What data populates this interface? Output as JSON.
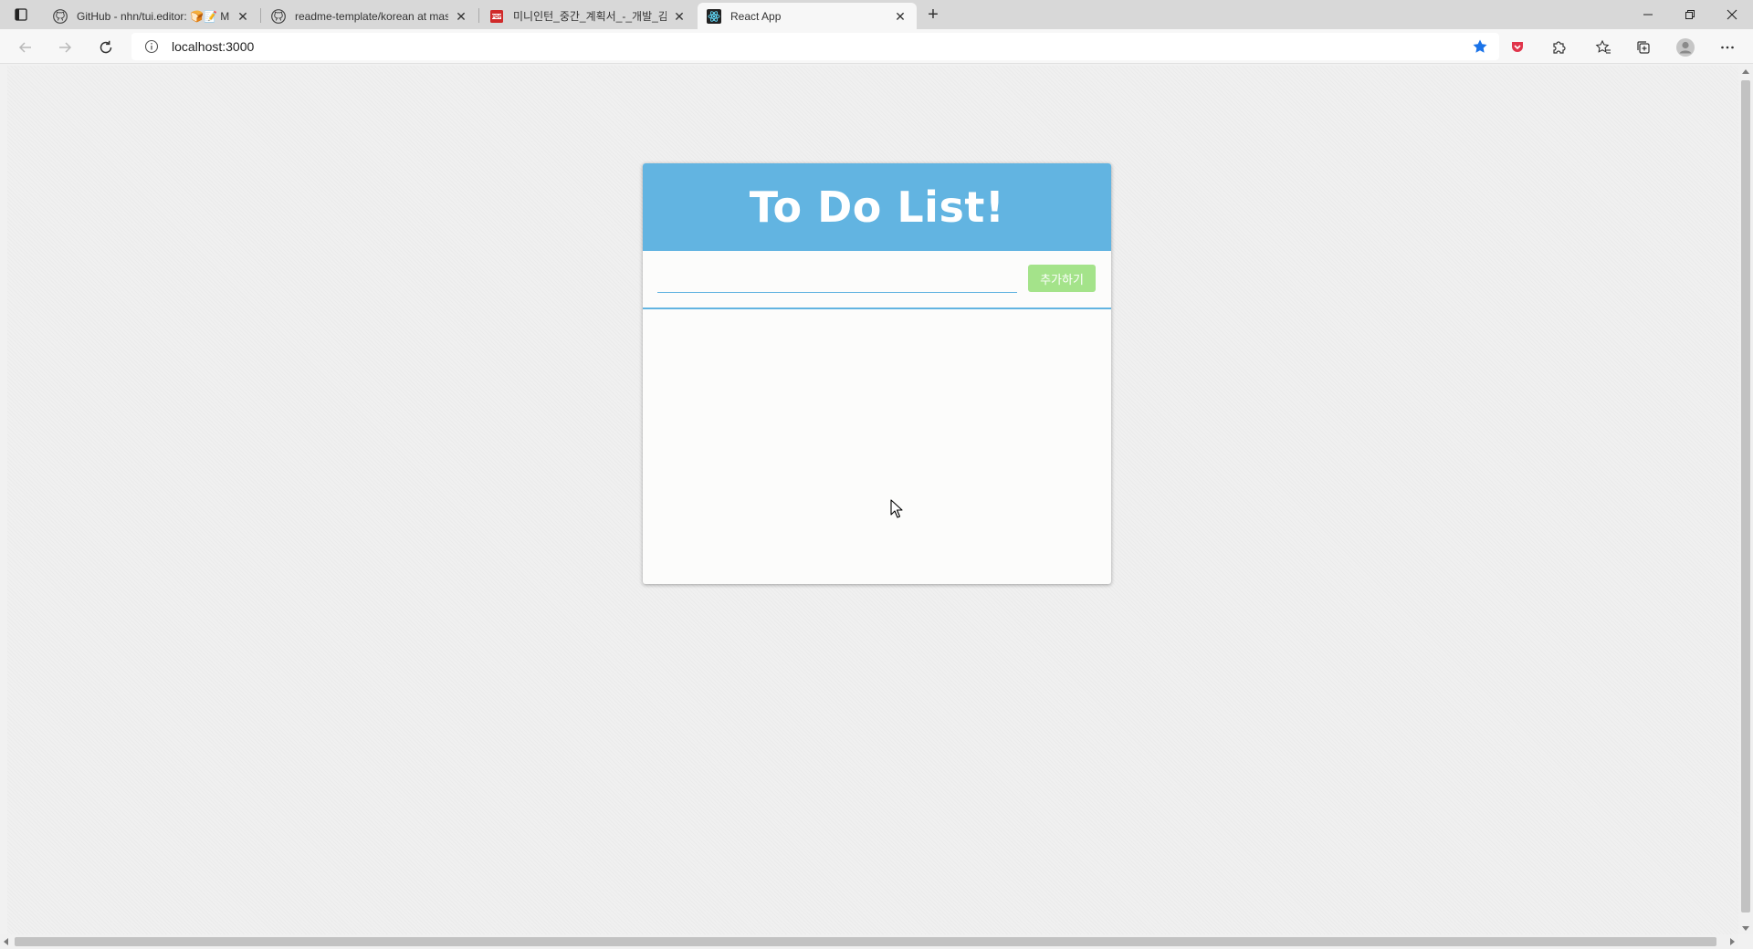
{
  "browser": {
    "tabs": [
      {
        "title": "GitHub - nhn/tui.editor: 🍞📝 M",
        "favicon": "github-icon",
        "active": false
      },
      {
        "title": "readme-template/korean at mas",
        "favicon": "github-icon",
        "active": false
      },
      {
        "title": "미니인턴_중간_계획서_-_개발_김",
        "favicon": "pdf-icon",
        "active": false
      },
      {
        "title": "React App",
        "favicon": "react-icon",
        "active": true
      }
    ],
    "address": {
      "url": "localhost:3000"
    }
  },
  "app": {
    "title": "To Do List!",
    "input": {
      "value": "",
      "placeholder": ""
    },
    "add_button_label": "추가하기",
    "items": []
  },
  "colors": {
    "header": "#62b4e1",
    "button": "#a4e38a",
    "bookmark_star": "#1a73e8"
  }
}
